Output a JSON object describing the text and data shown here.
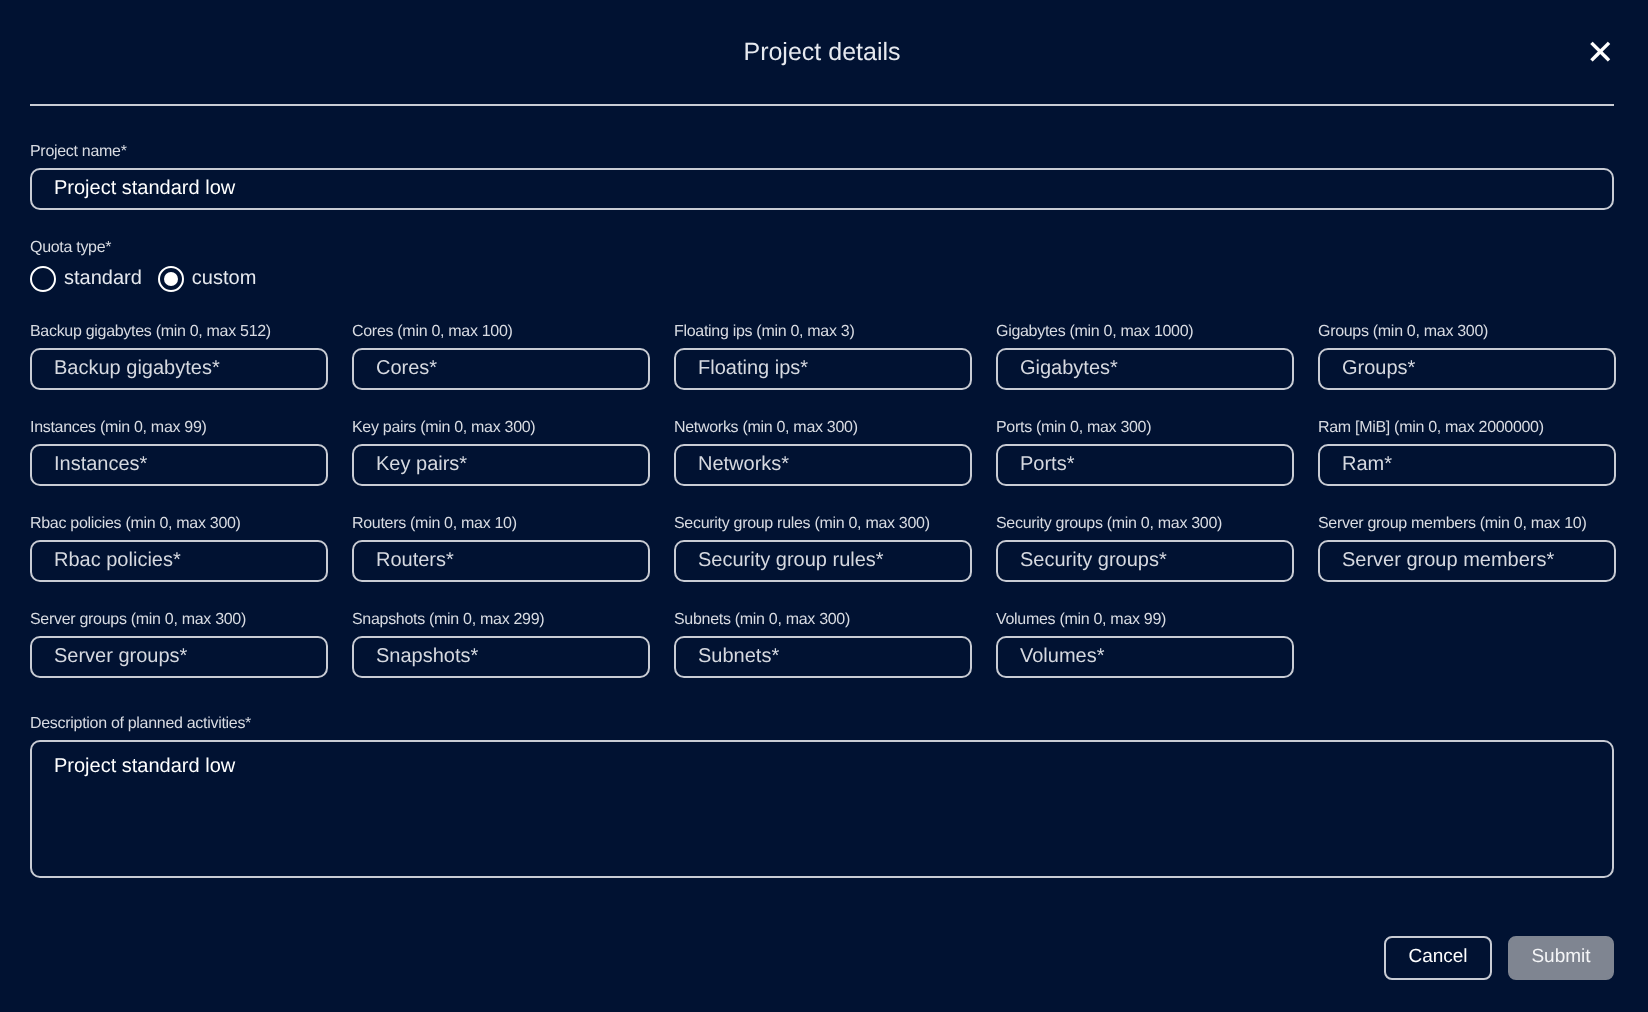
{
  "dialog": {
    "title": "Project details",
    "close": "✕"
  },
  "project_name": {
    "label": "Project name*",
    "value": "Project standard low"
  },
  "quota_type": {
    "label": "Quota type*",
    "options": [
      {
        "label": "standard",
        "selected": false
      },
      {
        "label": "custom",
        "selected": true
      }
    ]
  },
  "quota_fields": [
    {
      "label": "Backup gigabytes (min 0, max 512)",
      "placeholder": "Backup gigabytes*"
    },
    {
      "label": "Cores (min 0, max 100)",
      "placeholder": "Cores*"
    },
    {
      "label": "Floating ips (min 0, max 3)",
      "placeholder": "Floating ips*"
    },
    {
      "label": "Gigabytes (min 0, max 1000)",
      "placeholder": "Gigabytes*"
    },
    {
      "label": "Groups (min 0, max 300)",
      "placeholder": "Groups*"
    },
    {
      "label": "Instances (min 0, max 99)",
      "placeholder": "Instances*"
    },
    {
      "label": "Key pairs (min 0, max 300)",
      "placeholder": "Key pairs*"
    },
    {
      "label": "Networks (min 0, max 300)",
      "placeholder": "Networks*"
    },
    {
      "label": "Ports (min 0, max 300)",
      "placeholder": "Ports*"
    },
    {
      "label": "Ram [MiB] (min 0, max 2000000)",
      "placeholder": "Ram*"
    },
    {
      "label": "Rbac policies (min 0, max 300)",
      "placeholder": "Rbac policies*"
    },
    {
      "label": "Routers (min 0, max 10)",
      "placeholder": "Routers*"
    },
    {
      "label": "Security group rules (min 0, max 300)",
      "placeholder": "Security group rules*"
    },
    {
      "label": "Security groups (min 0, max 300)",
      "placeholder": "Security groups*"
    },
    {
      "label": "Server group members (min 0, max 10)",
      "placeholder": "Server group members*"
    },
    {
      "label": "Server groups (min 0, max 300)",
      "placeholder": "Server groups*"
    },
    {
      "label": "Snapshots (min 0, max 299)",
      "placeholder": "Snapshots*"
    },
    {
      "label": "Subnets (min 0, max 300)",
      "placeholder": "Subnets*"
    },
    {
      "label": "Volumes (min 0, max 99)",
      "placeholder": "Volumes*"
    }
  ],
  "description": {
    "label": "Description of planned activities*",
    "value": "Project standard low"
  },
  "buttons": [
    {
      "label": "Cancel",
      "kind": "outline",
      "disabled": false
    },
    {
      "label": "Submit",
      "kind": "filled",
      "disabled": true
    }
  ]
}
